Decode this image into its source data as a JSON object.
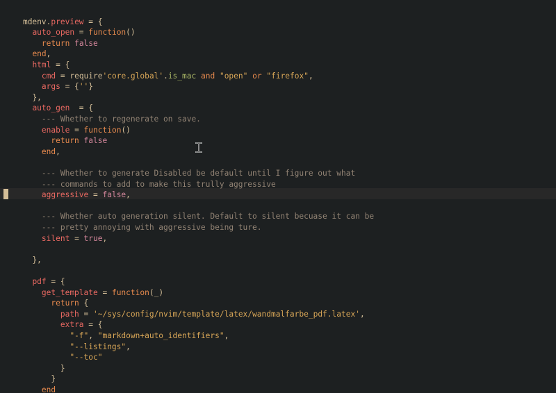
{
  "editor": {
    "lines": [
      [
        "mdenv",
        ".",
        "preview",
        " = {"
      ],
      [
        "  ",
        "auto_open",
        " = ",
        "function",
        "()"
      ],
      [
        "    ",
        "return",
        " ",
        "false"
      ],
      [
        "  ",
        "end",
        ","
      ],
      [
        "  ",
        "html",
        " = {"
      ],
      [
        "    ",
        "cmd",
        " = ",
        "require",
        "'core.global'",
        ".",
        "is_mac",
        " ",
        "and",
        " ",
        "\"open\"",
        " ",
        "or",
        " ",
        "\"firefox\"",
        ","
      ],
      [
        "    ",
        "args",
        " = {",
        "''",
        "}"
      ],
      [
        "  ",
        "},"
      ],
      [
        "  ",
        "auto_gen",
        "  = {"
      ],
      [
        "    ",
        "--- Whether to regenerate on save."
      ],
      [
        "    ",
        "enable",
        " = ",
        "function",
        "()"
      ],
      [
        "      ",
        "return",
        " ",
        "false"
      ],
      [
        "    ",
        "end",
        ","
      ],
      [
        ""
      ],
      [
        "    ",
        "--- Whether to generate Disabled be default until I figure out what"
      ],
      [
        "    ",
        "--- commands to add to make this trully aggressive"
      ],
      [
        "    ",
        "aggressive",
        " = ",
        "false",
        ","
      ],
      [
        ""
      ],
      [
        "    ",
        "--- Whether auto generation silent. Default to silent becuase it can be"
      ],
      [
        "    ",
        "--- pretty annoying with aggressive being ture."
      ],
      [
        "    ",
        "silent",
        " = ",
        "true",
        ","
      ],
      [
        ""
      ],
      [
        "  ",
        "},"
      ],
      [
        ""
      ],
      [
        "  ",
        "pdf",
        " = {"
      ],
      [
        "    ",
        "get_template",
        " = ",
        "function",
        "(_)"
      ],
      [
        "      ",
        "return",
        " {"
      ],
      [
        "        ",
        "path",
        " = ",
        "'~/sys/config/nvim/template/latex/wandmalfarbe_pdf.latex'",
        ","
      ],
      [
        "        ",
        "extra",
        " = {"
      ],
      [
        "          ",
        "\"-f\"",
        ", ",
        "\"markdown+auto_identifiers\"",
        ","
      ],
      [
        "          ",
        "\"--listings\"",
        ","
      ],
      [
        "          ",
        "\"--toc\""
      ],
      [
        "        ",
        "}"
      ],
      [
        "      ",
        "}"
      ],
      [
        "    ",
        "end"
      ],
      [
        "  ",
        "}"
      ]
    ]
  },
  "colors": {
    "background": "#1d2021",
    "cursorline": "#282828",
    "foreground": "#d4be98",
    "field": "#ea6962",
    "keyword": "#e78a4e",
    "function": "#a9b665",
    "string": "#d8a657",
    "boolean": "#d3869b",
    "comment": "#928374"
  },
  "icons": {
    "mouse_cursor": "text-ibeam-icon"
  }
}
